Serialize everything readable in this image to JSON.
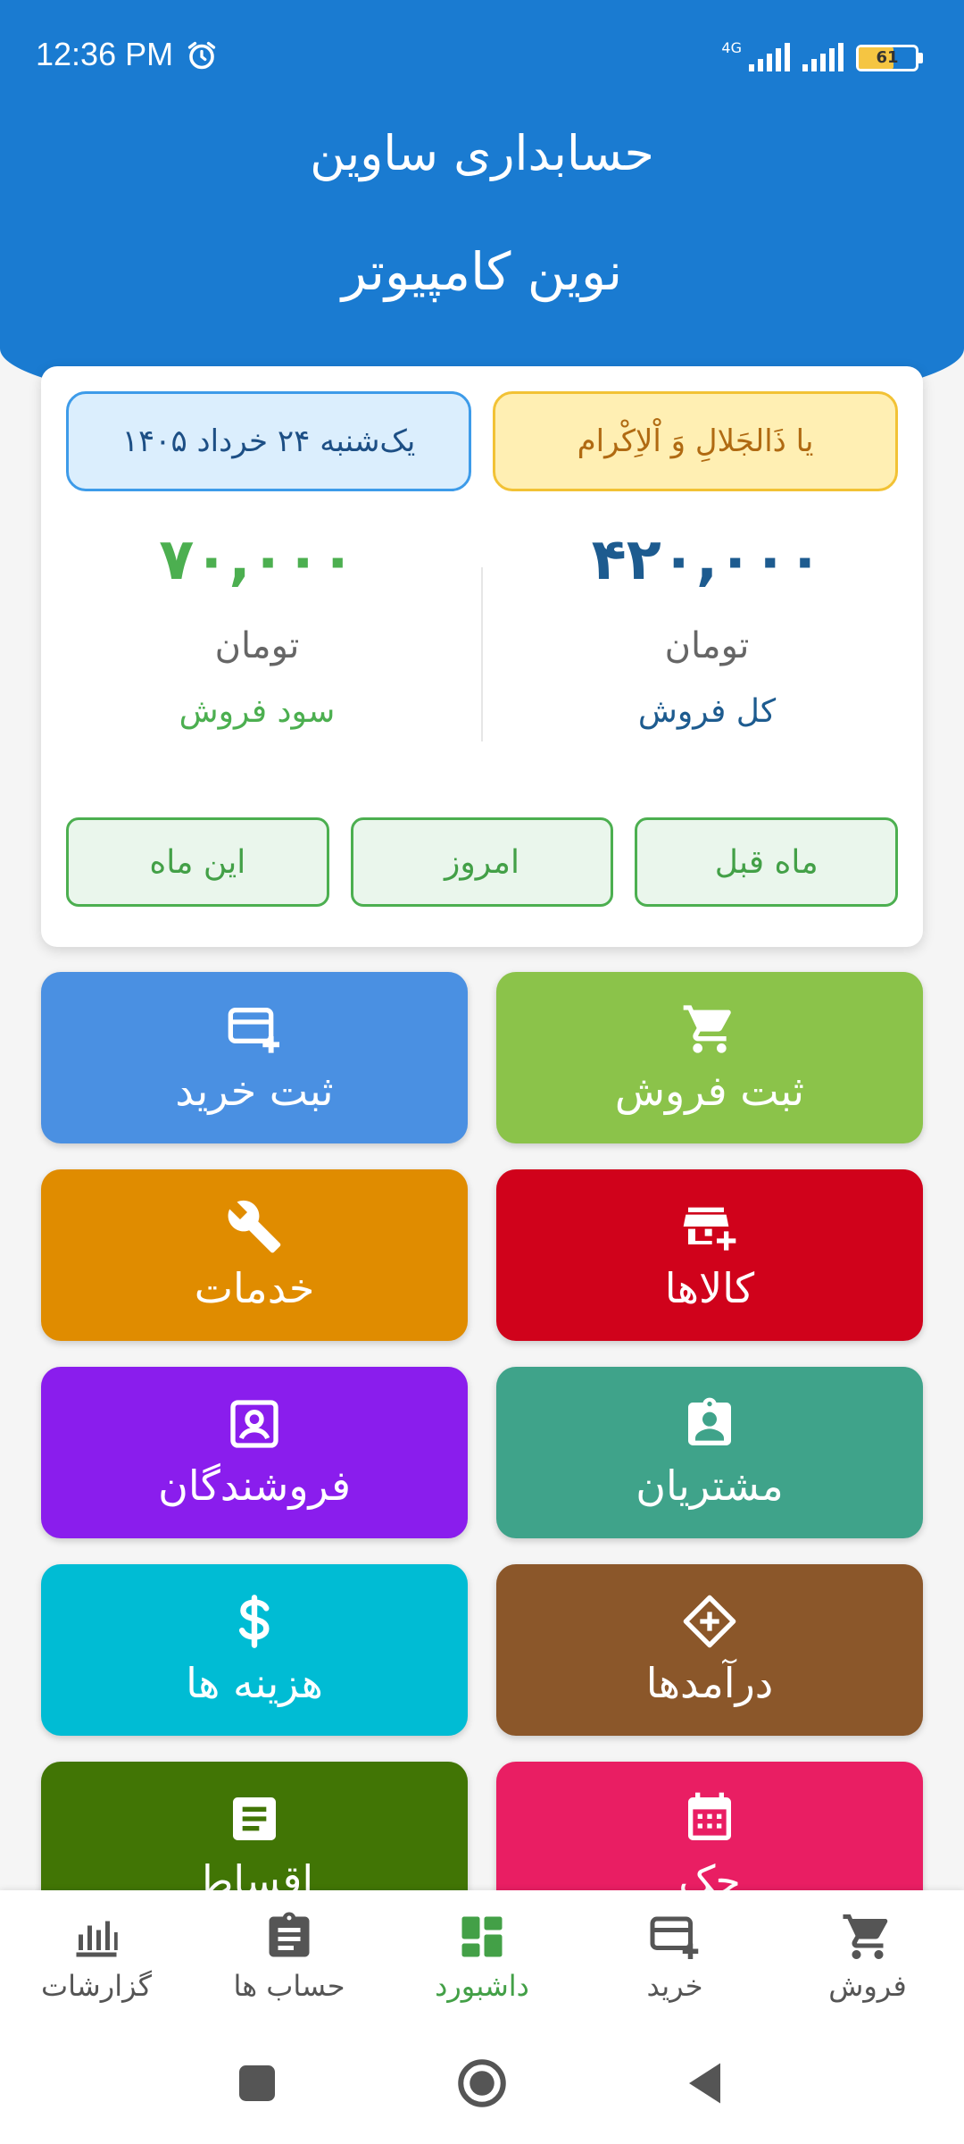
{
  "status_bar": {
    "time": "12:36 PM",
    "network": "4G",
    "battery": "61",
    "battery_level": 0.61,
    "icons": [
      "alarm-icon",
      "signal-icon",
      "battery-icon"
    ]
  },
  "header": {
    "app_title": "حسابداری ساوین",
    "company_name": "نوین کامپیوتر"
  },
  "summary": {
    "dua": "یا ذَالجَلالِ وَ اْلاِکْرام",
    "date": "یک‌شنبه ۲۴ خرداد ۱۴۰۵",
    "total_sales": {
      "value": "۴۲۰,۰۰۰",
      "unit": "تومان",
      "label": "کل فروش"
    },
    "sales_profit": {
      "value": "۷۰,۰۰۰",
      "unit": "تومان",
      "label": "سود فروش"
    },
    "periods": [
      "ماه قبل",
      "امروز",
      "این ماه"
    ]
  },
  "tiles": [
    {
      "label": "ثبت فروش",
      "icon": "cart-icon",
      "color": "#8bc34a"
    },
    {
      "label": "ثبت خرید",
      "icon": "card-add-icon",
      "color": "#4a90e2"
    },
    {
      "label": "کالاها",
      "icon": "store-add-icon",
      "color": "#d0021b"
    },
    {
      "label": "خدمات",
      "icon": "wrench-icon",
      "color": "#e08c00"
    },
    {
      "label": "مشتریان",
      "icon": "badge-icon",
      "color": "#3fa38a"
    },
    {
      "label": "فروشندگان",
      "icon": "portrait-icon",
      "color": "#8a1ded"
    },
    {
      "label": "درآمدها",
      "icon": "diamond-plus-icon",
      "color": "#8b572a"
    },
    {
      "label": "هزینه ها",
      "icon": "dollar-icon",
      "color": "#00bcd4"
    },
    {
      "label": "چک",
      "icon": "calendar-icon",
      "color": "#e91e63"
    },
    {
      "label": "اقساط",
      "icon": "document-icon",
      "color": "#417505"
    }
  ],
  "bottom_nav": [
    {
      "label": "فروش",
      "icon": "cart-icon"
    },
    {
      "label": "خرید",
      "icon": "card-add-icon"
    },
    {
      "label": "داشبورد",
      "icon": "dashboard-icon",
      "active": true
    },
    {
      "label": "حساب ها",
      "icon": "clipboard-icon"
    },
    {
      "label": "گزارشات",
      "icon": "bar-chart-icon"
    }
  ],
  "system_nav": [
    "recent-apps-icon",
    "home-icon",
    "back-icon"
  ],
  "colors": {
    "header": "#1a7bd1",
    "total_sales": "#1d5b8f",
    "profit": "#4caf50",
    "active_nav": "#43a047"
  }
}
